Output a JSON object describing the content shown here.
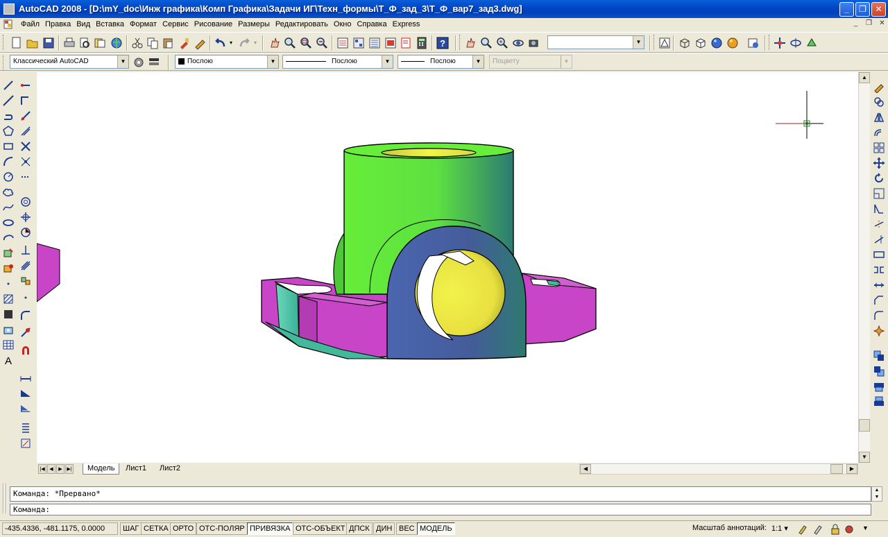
{
  "window": {
    "title": "AutoCAD 2008 - [D:\\mY_doc\\Инж графика\\Комп Графика\\Задачи ИГ\\Техн_формы\\Т_Ф_зад_3\\Т_Ф_вар7_зад3.dwg]",
    "minimize_glyph": "_",
    "maximize_glyph": "❐",
    "close_glyph": "✕"
  },
  "menu": {
    "items": [
      "Файл",
      "Правка",
      "Вид",
      "Вставка",
      "Формат",
      "Сервис",
      "Рисование",
      "Размеры",
      "Редактировать",
      "Окно",
      "Справка",
      "Express"
    ],
    "doc_controls": [
      "_",
      "❐",
      "✕"
    ]
  },
  "toolbar_properties": {
    "workspace": "Классический AutoCAD",
    "layer_color": "Послою",
    "linetype": "Послою",
    "lineweight": "Послою",
    "plotstyle": "Поцвету"
  },
  "toolbar_standard": {
    "view_combo": ""
  },
  "tabs": {
    "items": [
      "Модель",
      "Лист1",
      "Лист2"
    ],
    "active": "Модель"
  },
  "command": {
    "history_line": "Команда: *Прервано*",
    "prompt_line": "Команда:"
  },
  "status": {
    "coordinates": "-435.4336, -481.1175, 0.0000",
    "toggles": [
      {
        "label": "ШАГ",
        "on": false
      },
      {
        "label": "СЕТКА",
        "on": false
      },
      {
        "label": "ОРТО",
        "on": false
      },
      {
        "label": "ОТС-ПОЛЯР",
        "on": false
      },
      {
        "label": "ПРИВЯЗКА",
        "on": true
      },
      {
        "label": "ОТС-ОБЪЕКТ",
        "on": false
      },
      {
        "label": "ДПСК",
        "on": false
      },
      {
        "label": "ДИН",
        "on": false
      },
      {
        "label": "ВЕС",
        "on": false
      },
      {
        "label": "МОДЕЛЬ",
        "on": true
      }
    ],
    "annotation_scale_label": "Масштаб аннотаций:",
    "annotation_scale_value": "1:1 ▾"
  },
  "model_colors": {
    "magenta": "#c845c8",
    "green": "#66ee3a",
    "blue": "#4a66b0",
    "yellow": "#f2f24a",
    "teal": "#5ac8a8"
  }
}
